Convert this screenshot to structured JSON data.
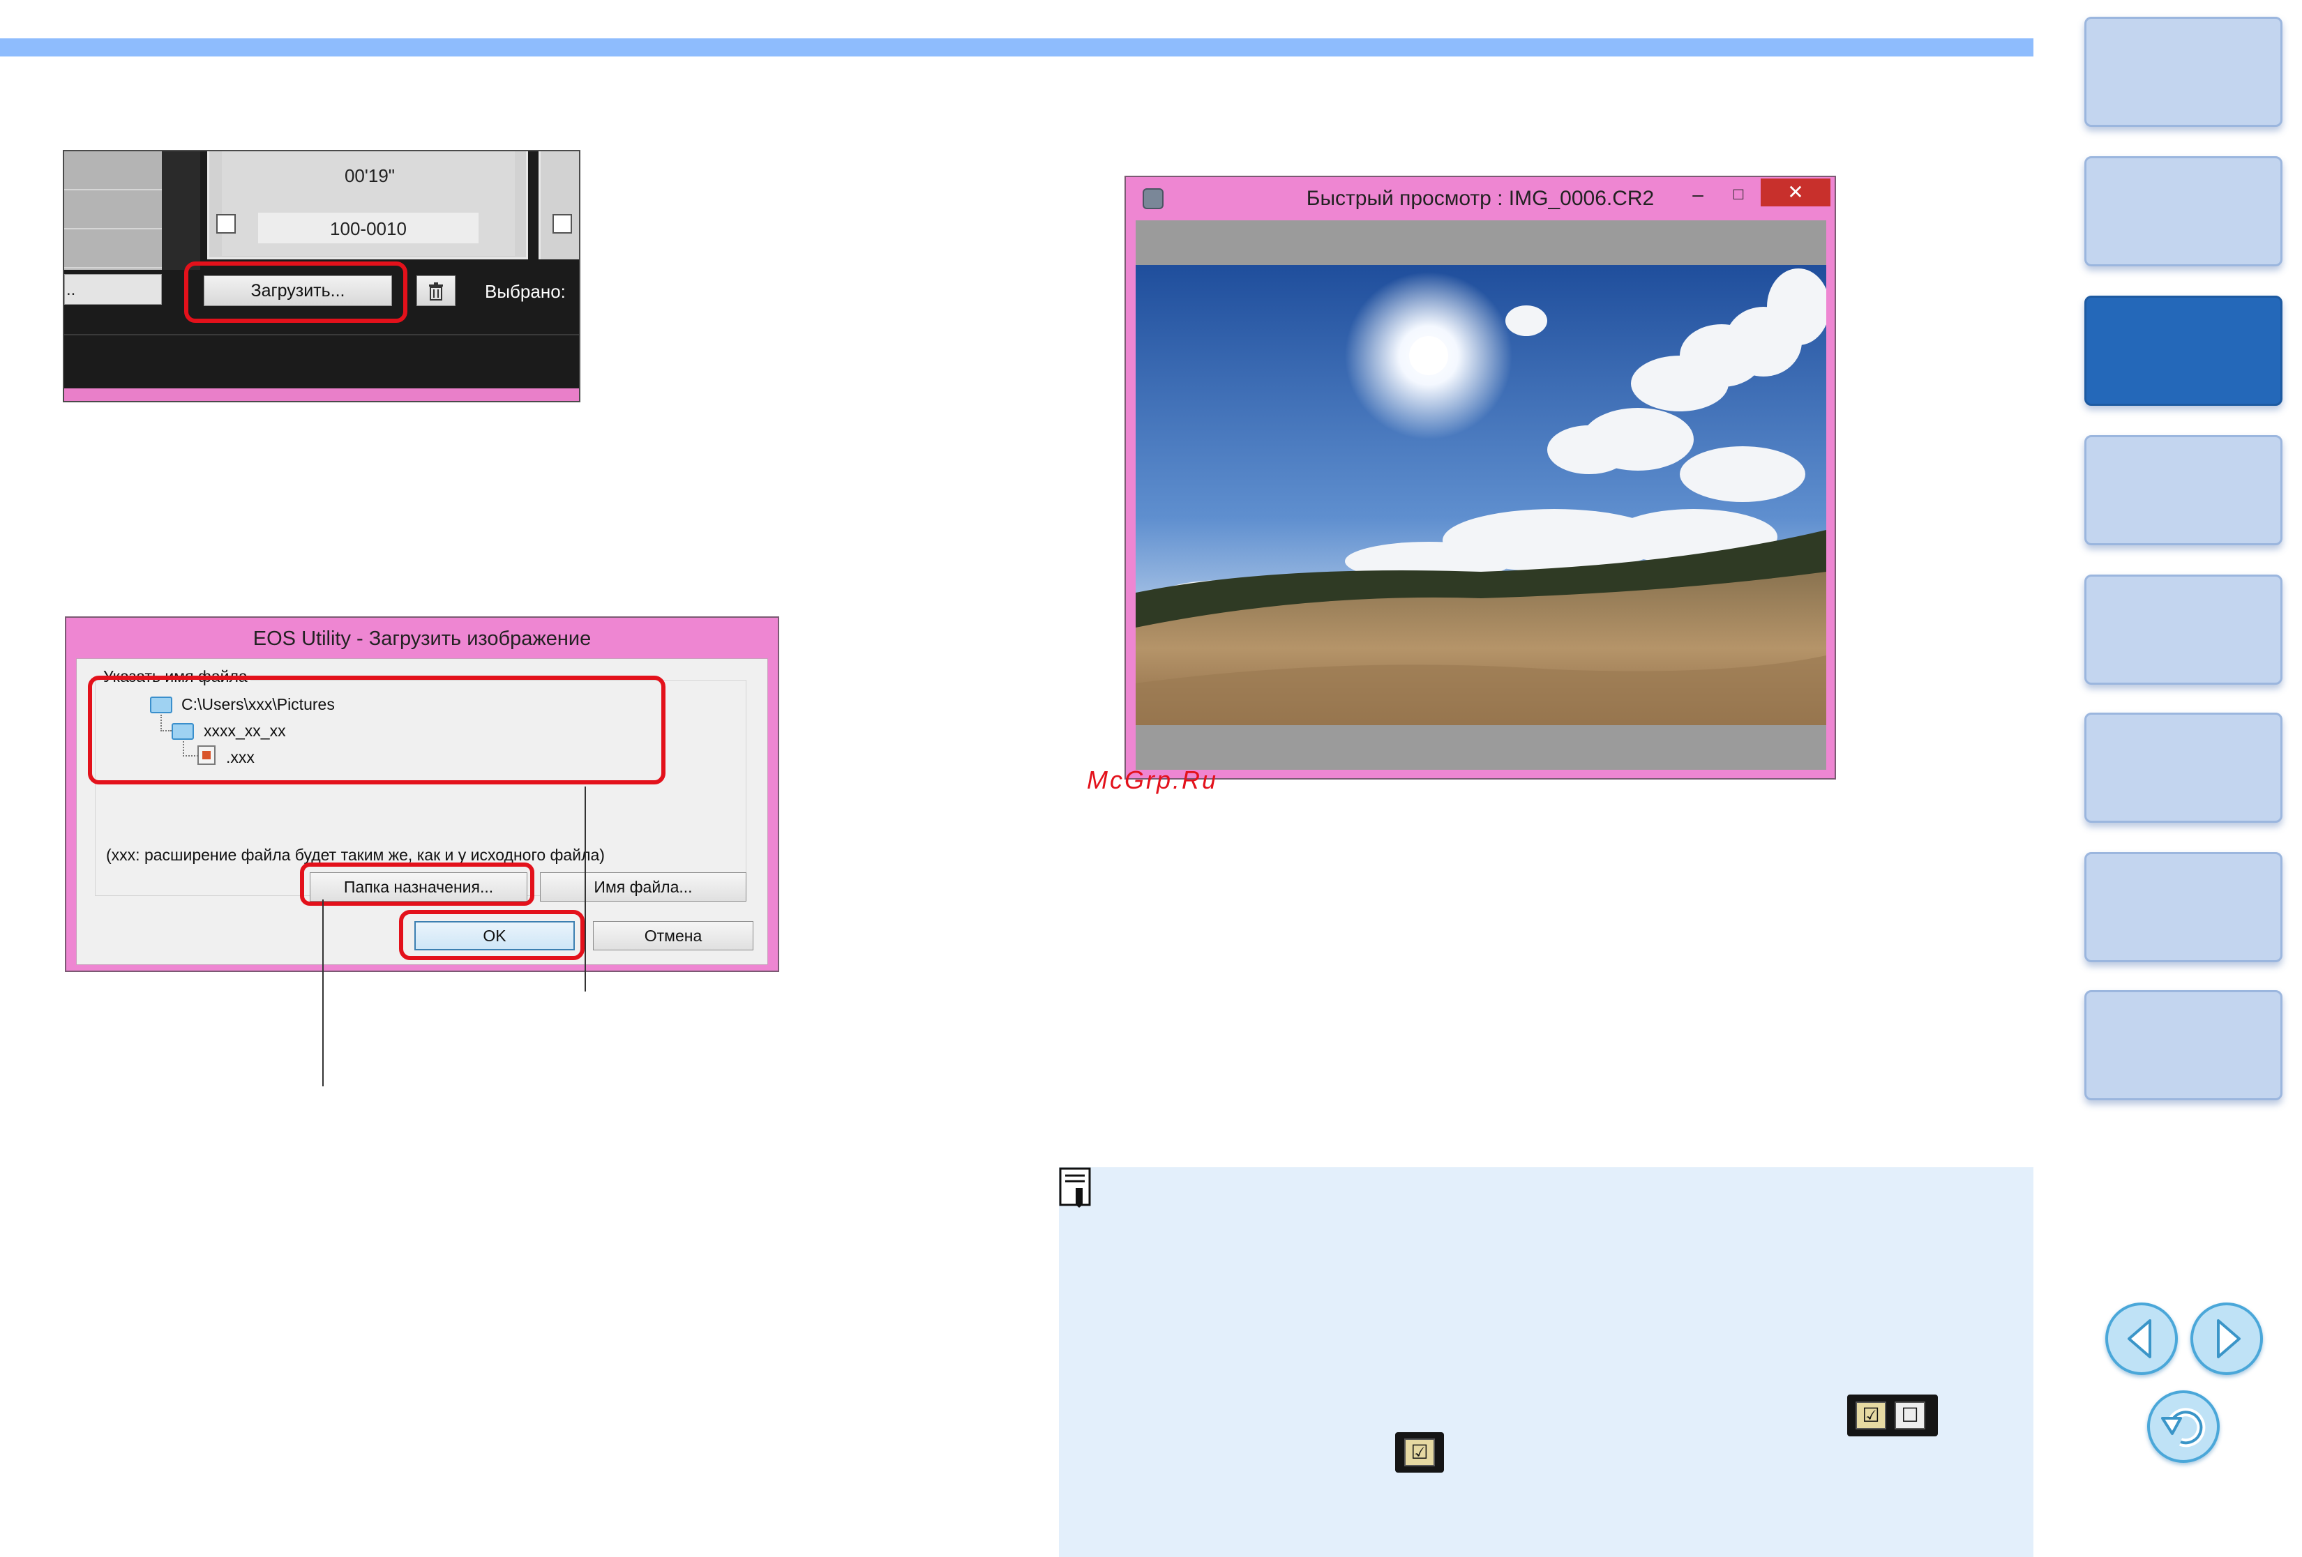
{
  "shot1": {
    "thumb_duration": "00'19\"",
    "thumb_filename": "100-0010",
    "left_button_partial": "..",
    "load_button": "Загрузить...",
    "delete_icon": "trash-icon",
    "selected_label": "Выбрано:"
  },
  "dialog": {
    "title": "EOS Utility - Загрузить изображение",
    "group_title": "Указать имя файла",
    "folder_path": "C:\\Users\\xxx\\Pictures",
    "subfolder": "xxxx_xx_xx",
    "file_ext": ".xxx",
    "ext_note": "(xxx: расширение файла будет таким же, как и у исходного файла)",
    "dest_folder_button": "Папка назначения...",
    "filename_button": "Имя файла...",
    "ok_button": "OK",
    "cancel_button": "Отмена"
  },
  "preview": {
    "title": "Быстрый просмотр : IMG_0006.CR2",
    "minimize": "–",
    "maximize": "□",
    "close": "✕"
  },
  "watermark": "McGrp.Ru",
  "memo": {
    "icon": "memo-icon",
    "check_on": "☑",
    "check_off": "☐"
  },
  "nav": {
    "tabs_count": 8,
    "active_tab": 3,
    "prev_icon": "prev-page-icon",
    "next_icon": "next-page-icon",
    "return_icon": "return-icon"
  },
  "colors": {
    "accent_bar": "#8ebcfd",
    "highlight": "#e3111b",
    "dialog_frame": "#ee86d2",
    "memo_bg": "#e3effb",
    "nav_tab": "#c3d5ef",
    "nav_active": "#2468b9"
  }
}
